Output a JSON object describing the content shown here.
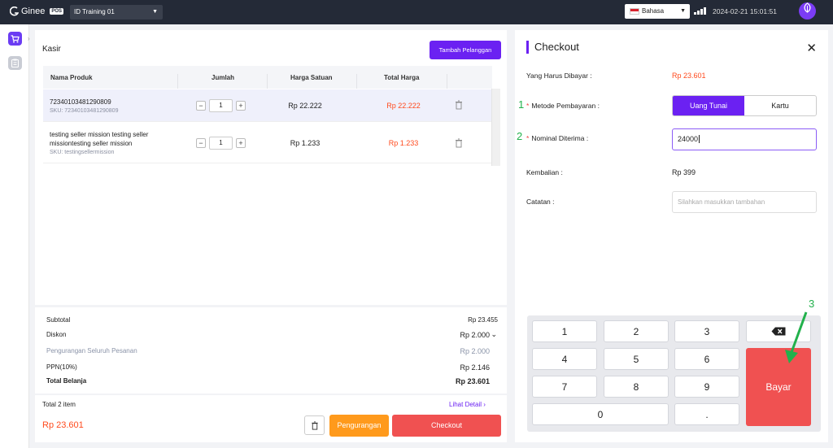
{
  "topbar": {
    "brand": "Ginee",
    "brand_badge": "POS",
    "store": "ID Training 01",
    "language": "Bahasa",
    "datetime": "2024-02-21 15:01:51"
  },
  "cart": {
    "title": "Kasir",
    "add_customer": "Tambah Pelanggan",
    "columns": [
      "Nama Produk",
      "Jumlah",
      "Harga Satuan",
      "Total Harga"
    ],
    "items": [
      {
        "name": "72340103481290809",
        "sku": "SKU: 72340103481290809",
        "qty": "1",
        "unit_price": "Rp 22.222",
        "total": "Rp 22.222"
      },
      {
        "name": "testing seller mission testing seller missiontesting seller mission",
        "sku": "SKU: testingsellermission",
        "qty": "1",
        "unit_price": "Rp 1.233",
        "total": "Rp 1.233"
      }
    ]
  },
  "summary": {
    "subtotal_label": "Subtotal",
    "subtotal": "Rp 23.455",
    "discount_label": "Diskon",
    "discount": "Rp 2.000",
    "order_reduction_label": "Pengurangan Seluruh Pesanan",
    "order_reduction": "Rp 2.000",
    "tax_label": "PPN(10%)",
    "tax": "Rp 2.146",
    "total_label": "Total Belanja",
    "total": "Rp 23.601"
  },
  "footer": {
    "item_count": "Total 2 item",
    "detail_link": "Lihat Detail",
    "grand_total": "Rp 23.601",
    "reduction_button": "Pengurangan",
    "checkout_button": "Checkout"
  },
  "checkout": {
    "title": "Checkout",
    "amount_due_label": "Yang Harus Dibayar",
    "amount_due": "Rp 23.601",
    "method_label": "Metode Pembayaran",
    "method_cash": "Uang Tunai",
    "method_card": "Kartu",
    "received_label": "Nominal Diterima",
    "received_value": "24000",
    "change_label": "Kembalian",
    "change_value": "Rp 399",
    "notes_label": "Catatan",
    "notes_placeholder": "Silahkan masukkan tambahan"
  },
  "annotations": {
    "one": "1",
    "two": "2",
    "three": "3",
    "color": "#22b14c"
  },
  "keypad": {
    "keys": [
      "1",
      "2",
      "3",
      "4",
      "5",
      "6",
      "7",
      "8",
      "9",
      "0",
      "."
    ],
    "pay_label": "Bayar"
  },
  "colors": {
    "accent": "#6b21f2",
    "price": "#ff4a1d",
    "checkout": "#f05151",
    "reduction": "#ff9a1c"
  }
}
